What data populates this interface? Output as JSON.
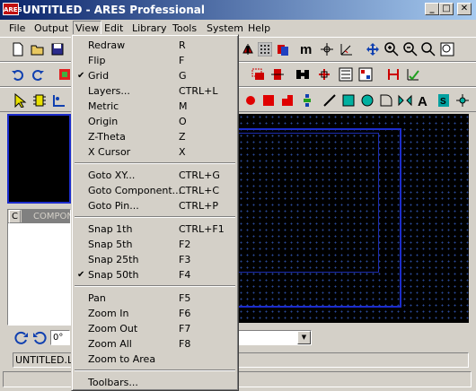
{
  "window": {
    "title": "UNTITLED - ARES Professional",
    "logo": "ARES",
    "minimize": "_",
    "maximize": "□",
    "close": "✕"
  },
  "menubar": [
    "File",
    "Output",
    "View",
    "Edit",
    "Library",
    "Tools",
    "System",
    "Help"
  ],
  "view_menu": {
    "groups": [
      [
        {
          "label": "Redraw",
          "shortcut": "R"
        },
        {
          "label": "Flip",
          "shortcut": "F"
        },
        {
          "label": "Grid",
          "shortcut": "G",
          "checked": true
        },
        {
          "label": "Layers...",
          "shortcut": "CTRL+L"
        },
        {
          "label": "Metric",
          "shortcut": "M"
        },
        {
          "label": "Origin",
          "shortcut": "O"
        },
        {
          "label": "Z-Theta",
          "shortcut": "Z"
        },
        {
          "label": "X Cursor",
          "shortcut": "X"
        }
      ],
      [
        {
          "label": "Goto XY...",
          "shortcut": "CTRL+G"
        },
        {
          "label": "Goto Component...",
          "shortcut": "CTRL+C"
        },
        {
          "label": "Goto Pin...",
          "shortcut": "CTRL+P"
        }
      ],
      [
        {
          "label": "Snap 1th",
          "shortcut": "CTRL+F1"
        },
        {
          "label": "Snap 5th",
          "shortcut": "F2"
        },
        {
          "label": "Snap 25th",
          "shortcut": "F3"
        },
        {
          "label": "Snap 50th",
          "shortcut": "F4",
          "checked": true
        }
      ],
      [
        {
          "label": "Pan",
          "shortcut": "F5"
        },
        {
          "label": "Zoom In",
          "shortcut": "F6"
        },
        {
          "label": "Zoom Out",
          "shortcut": "F7"
        },
        {
          "label": "Zoom All",
          "shortcut": "F8"
        },
        {
          "label": "Zoom to Area",
          "shortcut": ""
        }
      ],
      [
        {
          "label": "Toolbars...",
          "shortcut": ""
        }
      ]
    ]
  },
  "panel": {
    "tab_c": "C",
    "tab_components": "COMPONENTS"
  },
  "rotation": {
    "value": "0°"
  },
  "status": {
    "filename": "UNTITLED.LYT"
  },
  "colors": {
    "titlebar_start": "#0a246a",
    "titlebar_end": "#a6caf0",
    "canvas": "#000000",
    "board_outline": "#1c2ccc",
    "menu_bg": "#d4d0c8"
  }
}
